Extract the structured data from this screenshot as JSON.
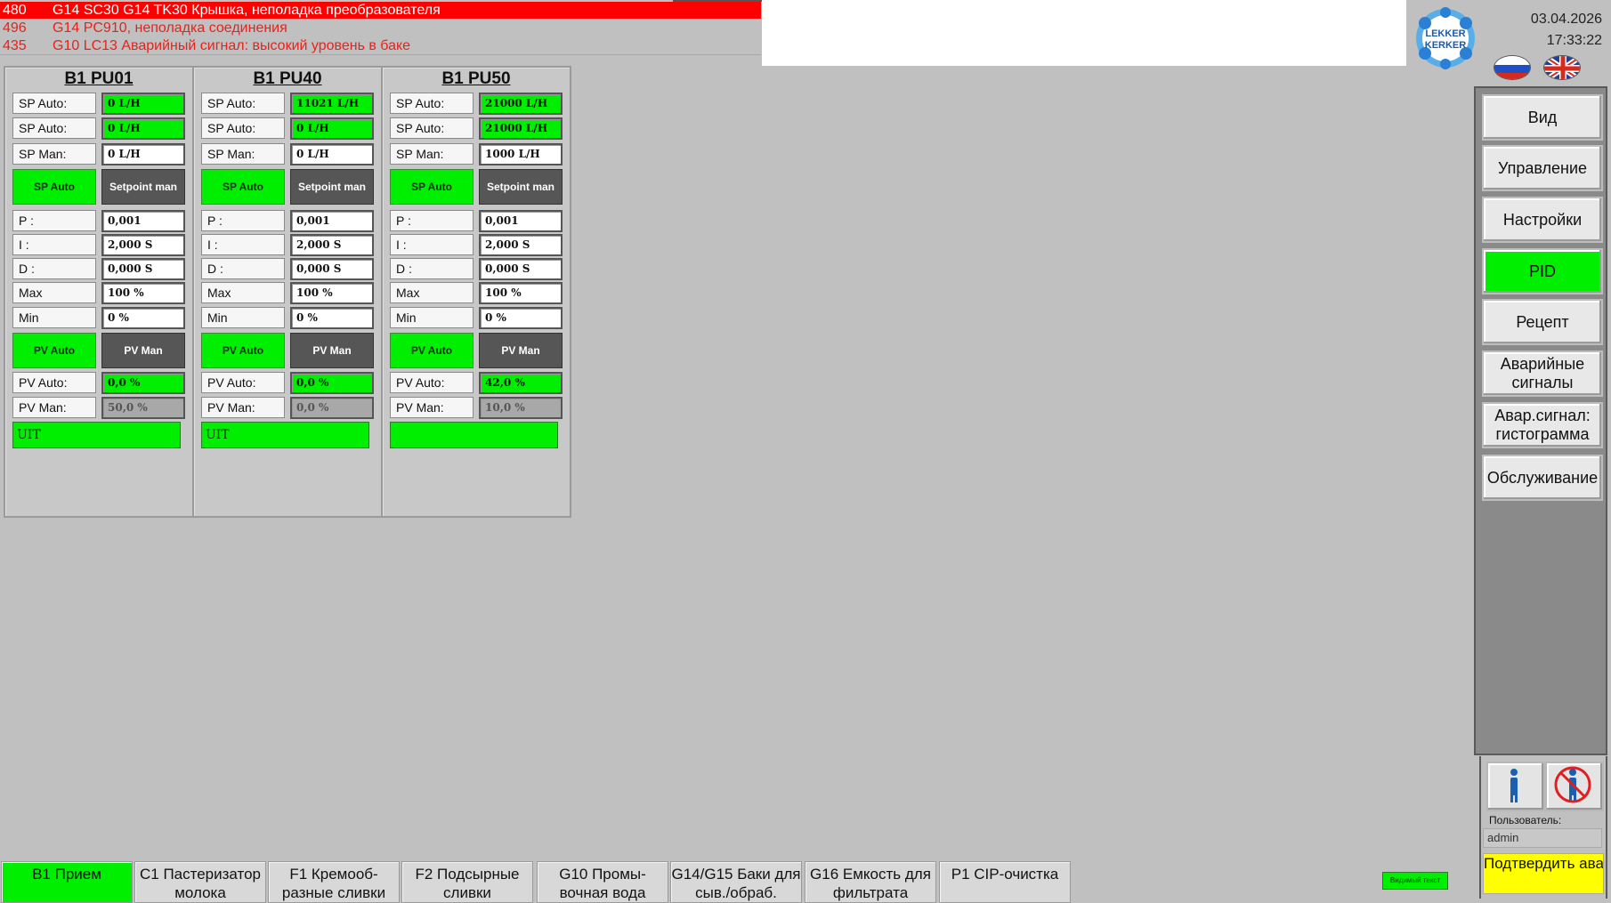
{
  "alarms": [
    {
      "num": "480",
      "text": "G14 SC30 G14 TK30 Крышка, неполадка преобразователя",
      "active": true
    },
    {
      "num": "496",
      "text": "G14 PC910, неполадка соединения",
      "active": false
    },
    {
      "num": "435",
      "text": "G10 LC13 Аварийный сигнал: высокий уровень в баке",
      "active": false
    }
  ],
  "header": {
    "logo_text_1": "LEKKER",
    "logo_text_2": "KERKER",
    "date": "03.04.2026",
    "time": "17:33:22"
  },
  "menu": [
    {
      "label": "Вид"
    },
    {
      "label": "Управление"
    },
    {
      "label": "Настройки"
    },
    {
      "label": "PID",
      "active": true
    },
    {
      "label": "Рецепт"
    },
    {
      "label": "Аварийные сигналы"
    },
    {
      "label": "Авар.сигнал: гистограмма"
    },
    {
      "label": "Обслуживание"
    }
  ],
  "user": {
    "label": "Пользователь:",
    "value": "admin",
    "confirm_label": "Подтвердить аварийный сигнал"
  },
  "panels": [
    {
      "title": "B1 PU01",
      "sp_auto_label": "SP Auto:",
      "sp_auto_1": "0 L/H",
      "sp_auto_2": "0 L/H",
      "sp_man_label": "SP Man:",
      "sp_man": "0 L/H",
      "btn_sp_auto": "SP Auto",
      "btn_setpoint_man": "Setpoint man",
      "p_label": "P :",
      "p": "0,001",
      "i_label": "I :",
      "i": "2,000 S",
      "d_label": "D :",
      "d": "0,000 S",
      "max_label": "Max",
      "max": "100 %",
      "min_label": "Min",
      "min": "0 %",
      "btn_pv_auto": "PV Auto",
      "btn_pv_man": "PV Man",
      "pv_auto_label": "PV Auto:",
      "pv_auto": "0,0 %",
      "pv_man_label": "PV Man:",
      "pv_man": "50,0 %",
      "status": "UIT"
    },
    {
      "title": "B1 PU40",
      "sp_auto_label": "SP Auto:",
      "sp_auto_1": "11021 L/H",
      "sp_auto_2": "0 L/H",
      "sp_man_label": "SP Man:",
      "sp_man": "0 L/H",
      "btn_sp_auto": "SP Auto",
      "btn_setpoint_man": "Setpoint man",
      "p_label": "P :",
      "p": "0,001",
      "i_label": "I :",
      "i": "2,000 S",
      "d_label": "D :",
      "d": "0,000 S",
      "max_label": "Max",
      "max": "100 %",
      "min_label": "Min",
      "min": "0 %",
      "btn_pv_auto": "PV Auto",
      "btn_pv_man": "PV Man",
      "pv_auto_label": "PV Auto:",
      "pv_auto": "0,0 %",
      "pv_man_label": "PV Man:",
      "pv_man": "0,0 %",
      "status": "UIT"
    },
    {
      "title": "B1 PU50",
      "sp_auto_label": "SP Auto:",
      "sp_auto_1": "21000 L/H",
      "sp_auto_2": "21000 L/H",
      "sp_man_label": "SP Man:",
      "sp_man": "1000 L/H",
      "btn_sp_auto": "SP Auto",
      "btn_setpoint_man": "Setpoint man",
      "p_label": "P :",
      "p": "0,001",
      "i_label": "I :",
      "i": "2,000 S",
      "d_label": "D :",
      "d": "0,000 S",
      "max_label": "Max",
      "max": "100 %",
      "min_label": "Min",
      "min": "0 %",
      "btn_pv_auto": "PV Auto",
      "btn_pv_man": "PV Man",
      "pv_auto_label": "PV Auto:",
      "pv_auto": "42,0 %",
      "pv_man_label": "PV Man:",
      "pv_man": "10,0 %",
      "status": ""
    }
  ],
  "tabs": [
    {
      "label": "B1 Прием",
      "active": true
    },
    {
      "label": "C1 Пастеризатор молока"
    },
    {
      "label": "F1 Кремооб-разные сливки"
    },
    {
      "label": "F2 Подсырные сливки"
    },
    {
      "label": "G10 Промы-вочная вода"
    },
    {
      "label": "G14/G15 Баки для сыв./обраб."
    },
    {
      "label": "G16 Емкость для фильтрата"
    },
    {
      "label": "P1 CIP-очистка"
    }
  ],
  "visible_text": "Видимый текст",
  "colors": {
    "accent_green": "#00ee00",
    "alarm_red": "#ff0000",
    "confirm_yellow": "#ffff00"
  }
}
